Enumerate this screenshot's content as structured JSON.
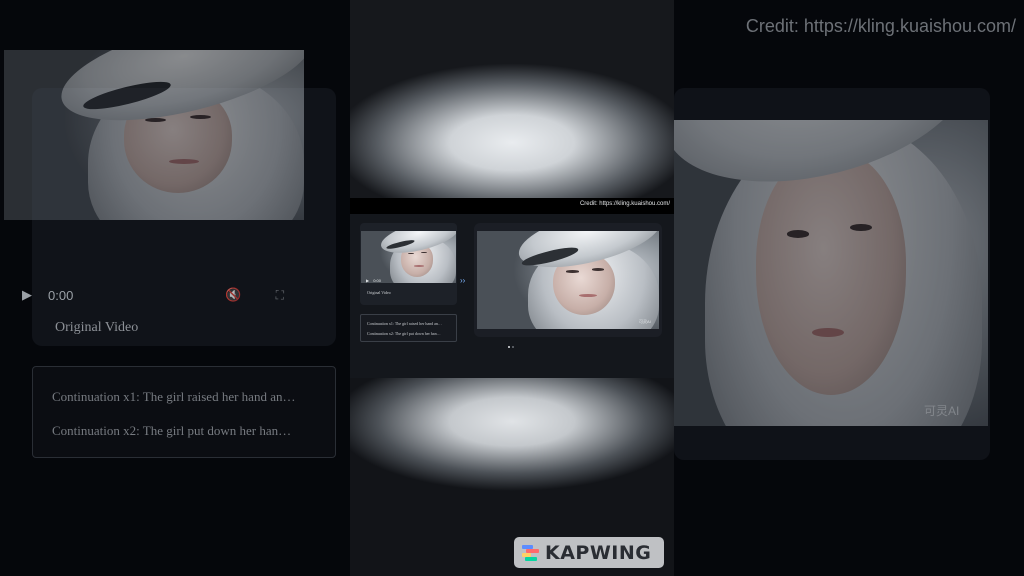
{
  "credit": {
    "large": "Credit: https://kling.kuaishou.com/",
    "small": "Credit: https://kling.kuaishou.com/"
  },
  "left_panel": {
    "play_icon": "play-icon",
    "time": "0:00",
    "label": "Original Video",
    "prompts": [
      "Continuation x1: The girl raised her hand an…",
      "Continuation x2: The girl put down her han…"
    ]
  },
  "center_panel": {
    "mini_player": {
      "time": "0:00",
      "label": "Original Video"
    },
    "mini_prompts": [
      "Continuation x1: The girl raised her hand an…",
      "Continuation x2: The girl put down her han…"
    ],
    "carousel": {
      "current_slide": 1,
      "total_slides": 2
    }
  },
  "right_panel": {
    "watermark": "可灵AI"
  },
  "kapwing": {
    "label": "KAPWING",
    "logo_colors": [
      "#5b8cff",
      "#ff6b6b",
      "#ffd166",
      "#06d6a0"
    ]
  },
  "colors": {
    "accent": "#7fb6ff",
    "panel": "#14171c"
  }
}
